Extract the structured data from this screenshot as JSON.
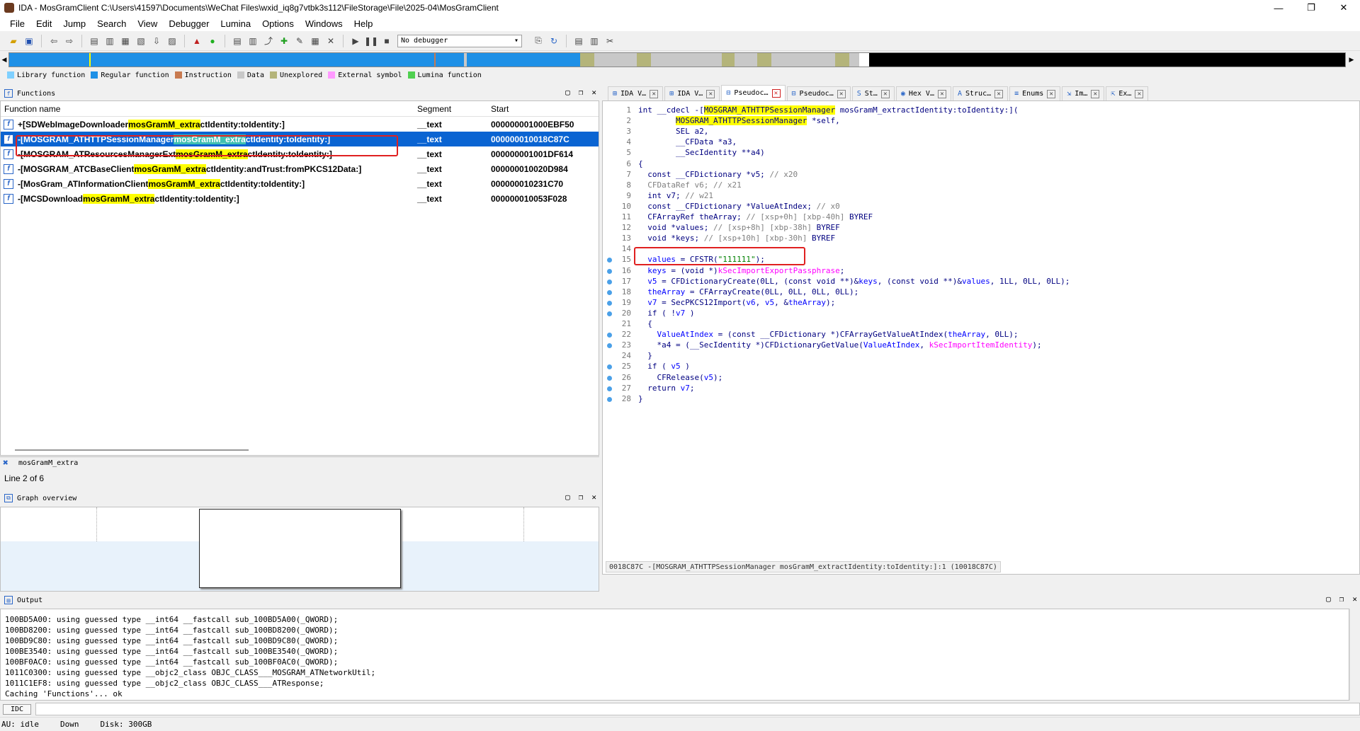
{
  "window": {
    "title": "IDA - MosGramClient C:\\Users\\41597\\Documents\\WeChat Files\\wxid_iq8g7vtbk3s112\\FileStorage\\File\\2025-04\\MosGramClient",
    "minimize": "—",
    "maximize": "❐",
    "close": "✕"
  },
  "menu": [
    "File",
    "Edit",
    "Jump",
    "Search",
    "View",
    "Debugger",
    "Lumina",
    "Options",
    "Windows",
    "Help"
  ],
  "toolbar": {
    "debugger_select": "No debugger"
  },
  "legend": [
    {
      "label": "Library function",
      "color": "#7fd0ff"
    },
    {
      "label": "Regular function",
      "color": "#1e90e6"
    },
    {
      "label": "Instruction",
      "color": "#c87a50"
    },
    {
      "label": "Data",
      "color": "#c8c8c8"
    },
    {
      "label": "Unexplored",
      "color": "#b4b47a"
    },
    {
      "label": "External symbol",
      "color": "#ff99ff"
    },
    {
      "label": "Lumina function",
      "color": "#50d050"
    }
  ],
  "functions": {
    "title": "Functions",
    "columns": [
      "Function name",
      "Segment",
      "Start"
    ],
    "rows": [
      {
        "pre": "+[SDWebImageDownloader ",
        "hl": "mosGramM_extra",
        "post": "ctIdentity:toIdentity:]",
        "segment": "__text",
        "start": "000000001000EBF50",
        "selected": false
      },
      {
        "pre": "-[MOSGRAM_ATHTTPSessionManager ",
        "hl": "mosGramM_extra",
        "post": "ctIdentity:toIdentity:]",
        "segment": "__text",
        "start": "000000010018C87C",
        "selected": true
      },
      {
        "pre": "-[MOSGRAM_ATResourcesManagerExt ",
        "hl": "mosGramM_extra",
        "post": "ctIdentity:toIdentity:]",
        "segment": "__text",
        "start": "000000001001DF614",
        "selected": false
      },
      {
        "pre": "-[MOSGRAM_ATCBaseClient ",
        "hl": "mosGramM_extra",
        "post": "ctIdentity:andTrust:fromPKCS12Data:]",
        "segment": "__text",
        "start": "000000010020D984",
        "selected": false
      },
      {
        "pre": "-[MosGram_ATInformationClient ",
        "hl": "mosGramM_extra",
        "post": "ctIdentity:toIdentity:]",
        "segment": "__text",
        "start": "000000010231C70",
        "selected": false
      },
      {
        "pre": "-[MCSDownload ",
        "hl": "mosGramM_extra",
        "post": "ctIdentity:toIdentity:]",
        "segment": "__text",
        "start": "000000010053F028",
        "selected": false
      }
    ],
    "filter_text": "mosGramM_extra",
    "line_count": "Line 2 of 6"
  },
  "graph_overview": {
    "title": "Graph overview"
  },
  "tabs": [
    {
      "label": "IDA V…",
      "icon": "graph-icon"
    },
    {
      "label": "IDA V…",
      "icon": "graph-icon"
    },
    {
      "label": "Pseudoc…",
      "icon": "pseudo-icon",
      "active": true
    },
    {
      "label": "Pseudoc…",
      "icon": "pseudo-icon"
    },
    {
      "label": "St…",
      "icon": "string-icon"
    },
    {
      "label": "Hex V…",
      "icon": "hex-icon"
    },
    {
      "label": "Struc…",
      "icon": "struct-icon"
    },
    {
      "label": "Enums",
      "icon": "enum-icon"
    },
    {
      "label": "Im…",
      "icon": "import-icon"
    },
    {
      "label": "Ex…",
      "icon": "export-icon"
    }
  ],
  "pseudocode": {
    "lines": [
      {
        "n": "1",
        "dot": false,
        "html": "int __cdecl -[<span class=\"hl\">MOSGRAM_ATHTTPSessionManager</span> mosGramM_extractIdentity:toIdentity:]("
      },
      {
        "n": "2",
        "dot": false,
        "html": "        <span class=\"hl\">MOSGRAM_ATHTTPSessionManager</span> *self,"
      },
      {
        "n": "3",
        "dot": false,
        "html": "        SEL a2,"
      },
      {
        "n": "4",
        "dot": false,
        "html": "        __CFData *a3,"
      },
      {
        "n": "5",
        "dot": false,
        "html": "        __SecIdentity **a4)"
      },
      {
        "n": "6",
        "dot": false,
        "html": "{"
      },
      {
        "n": "7",
        "dot": false,
        "html": "  const __CFDictionary *v5; <span class=\"c-cm\">// x20</span>"
      },
      {
        "n": "8",
        "dot": false,
        "html": "  <span class=\"c-cm\">CFDataRef v6; // x21</span>"
      },
      {
        "n": "9",
        "dot": false,
        "html": "  int v7; <span class=\"c-cm\">// w21</span>"
      },
      {
        "n": "10",
        "dot": false,
        "html": "  const __CFDictionary *ValueAtIndex; <span class=\"c-cm\">// x0</span>"
      },
      {
        "n": "11",
        "dot": false,
        "html": "  CFArrayRef theArray; <span class=\"c-cm\">// [xsp+0h] [xbp-40h]</span> BYREF"
      },
      {
        "n": "12",
        "dot": false,
        "html": "  void *values; <span class=\"c-cm\">// [xsp+8h] [xbp-38h]</span> BYREF"
      },
      {
        "n": "13",
        "dot": false,
        "html": "  void *keys; <span class=\"c-cm\">// [xsp+10h] [xbp-30h]</span> BYREF"
      },
      {
        "n": "14",
        "dot": false,
        "html": ""
      },
      {
        "n": "15",
        "dot": true,
        "html": "  <span class=\"c-var\">values</span> = CFSTR(<span class=\"c-str\">\"111111\"</span>);"
      },
      {
        "n": "16",
        "dot": true,
        "html": "  <span class=\"c-var\">keys</span> = (void *)<span class=\"c-ext\">kSecImportExportPassphrase</span>;"
      },
      {
        "n": "17",
        "dot": true,
        "html": "  <span class=\"c-var\">v5</span> = CFDictionaryCreate(0LL, (const void **)&amp;<span class=\"c-var\">keys</span>, (const void **)&amp;<span class=\"c-var\">values</span>, 1LL, 0LL, 0LL);"
      },
      {
        "n": "18",
        "dot": true,
        "html": "  <span class=\"c-var\">theArray</span> = CFArrayCreate(0LL, 0LL, 0LL, 0LL);"
      },
      {
        "n": "19",
        "dot": true,
        "html": "  <span class=\"c-var\">v7</span> = SecPKCS12Import(<span class=\"c-var\">v6</span>, <span class=\"c-var\">v5</span>, &amp;<span class=\"c-var\">theArray</span>);"
      },
      {
        "n": "20",
        "dot": true,
        "html": "  if ( !<span class=\"c-var\">v7</span> )"
      },
      {
        "n": "21",
        "dot": false,
        "html": "  {"
      },
      {
        "n": "22",
        "dot": true,
        "html": "    <span class=\"c-var\">ValueAtIndex</span> = (const __CFDictionary *)CFArrayGetValueAtIndex(<span class=\"c-var\">theArray</span>, 0LL);"
      },
      {
        "n": "23",
        "dot": true,
        "html": "    *a4 = (__SecIdentity *)CFDictionaryGetValue(<span class=\"c-var\">ValueAtIndex</span>, <span class=\"c-ext\">kSecImportItemIdentity</span>);"
      },
      {
        "n": "24",
        "dot": false,
        "html": "  }"
      },
      {
        "n": "25",
        "dot": true,
        "html": "  if ( <span class=\"c-var\">v5</span> )"
      },
      {
        "n": "26",
        "dot": true,
        "html": "    CFRelease(<span class=\"c-var\">v5</span>);"
      },
      {
        "n": "27",
        "dot": true,
        "html": "  return <span class=\"c-var\">v7</span>;"
      },
      {
        "n": "28",
        "dot": true,
        "html": "}"
      }
    ],
    "status": "0018C87C -[MOSGRAM_ATHTTPSessionManager mosGramM_extractIdentity:toIdentity:]:1 (10018C87C)"
  },
  "output": {
    "title": "Output",
    "lines": [
      "100BD5A00: using guessed type __int64 __fastcall sub_100BD5A00(_QWORD);",
      "100BD8200: using guessed type __int64 __fastcall sub_100BD8200(_QWORD);",
      "100BD9C80: using guessed type __int64 __fastcall sub_100BD9C80(_QWORD);",
      "100BE3540: using guessed type __int64 __fastcall sub_100BE3540(_QWORD);",
      "100BF0AC0: using guessed type __int64 __fastcall sub_100BF0AC0(_QWORD);",
      "1011C0300: using guessed type __objc2_class OBJC_CLASS___MOSGRAM_ATNetworkUtil;",
      "1011C1EF8: using guessed type __objc2_class OBJC_CLASS___ATResponse;",
      "Caching 'Functions'... ok"
    ],
    "idc_label": "IDC"
  },
  "status": {
    "au": "AU:",
    "au_state": "idle",
    "direction": "Down",
    "disk": "Disk: 300GB"
  }
}
